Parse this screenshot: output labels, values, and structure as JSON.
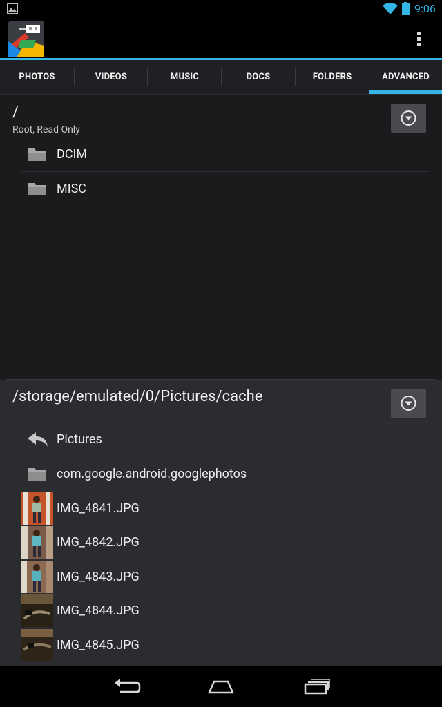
{
  "status_bar": {
    "time": "9:06",
    "icons": [
      "image-notification-icon",
      "wifi-icon",
      "battery-icon"
    ]
  },
  "action_bar": {
    "app_icon": "usb-file-manager-app-icon",
    "overflow_icon": "overflow-menu-icon"
  },
  "tabs": [
    {
      "label": "PHOTOS",
      "active": false
    },
    {
      "label": "VIDEOS",
      "active": false
    },
    {
      "label": "MUSIC",
      "active": false
    },
    {
      "label": "DOCS",
      "active": false
    },
    {
      "label": "FOLDERS",
      "active": false
    },
    {
      "label": "ADVANCED",
      "active": true
    }
  ],
  "pane_top": {
    "path": "/",
    "subtitle": "Root, Read Only",
    "items": [
      {
        "type": "folder",
        "name": "DCIM"
      },
      {
        "type": "folder",
        "name": "MISC"
      }
    ]
  },
  "pane_bottom": {
    "path": "/storage/emulated/0/Pictures/cache",
    "items": [
      {
        "type": "back",
        "name": "Pictures"
      },
      {
        "type": "folder",
        "name": "com.google.android.googlephotos"
      },
      {
        "type": "image",
        "name": "IMG_4841.JPG"
      },
      {
        "type": "image",
        "name": "IMG_4842.JPG"
      },
      {
        "type": "image",
        "name": "IMG_4843.JPG"
      },
      {
        "type": "image",
        "name": "IMG_4844.JPG"
      },
      {
        "type": "image",
        "name": "IMG_4845.JPG"
      }
    ]
  },
  "nav_bar": {
    "buttons": [
      "back-icon",
      "home-icon",
      "recent-apps-icon"
    ]
  },
  "colors": {
    "accent": "#33b5e5",
    "background": "#1a1b1d",
    "pane_bottom_background": "#2a2c30"
  }
}
